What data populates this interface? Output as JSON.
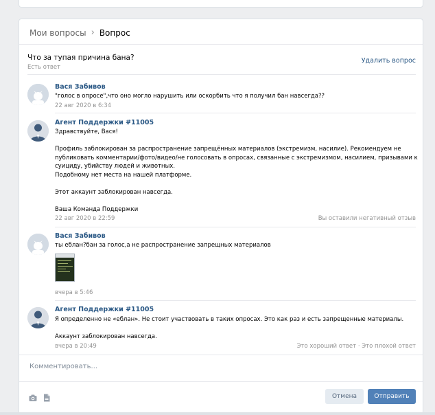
{
  "breadcrumb": {
    "parent": "Мои вопросы",
    "separator": "›",
    "current": "Вопрос"
  },
  "question": {
    "title": "Что за тупая причина бана?",
    "status": "Есть ответ",
    "delete_label": "Удалить вопрос"
  },
  "messages": [
    {
      "author": "Вася Забивов",
      "text": "\"голос в опросе\",что оно могло нарушить или оскорбить что я получил бан навсегда??",
      "date": "22 авг 2020 в 6:34"
    },
    {
      "author": "Агент Поддержки #11005",
      "text": "Здравствуйте, Вася!\n\nПрофиль заблокирован за распространение запрещённых материалов (экстремизм, насилие). Рекомендуем не публиковать комментарии/фото/видео/не голосовать в опросах, связанные с экстремизмом, насилием, призывами к суициду, убийству людей и животных.\nПодобному нет места на нашей платформе.\n\nЭтот аккаунт заблокирован навсегда.\n\nВаша Команда Поддержки",
      "date": "22 авг 2020 в 22:59",
      "rating": "Вы оставили негативный отзыв"
    },
    {
      "author": "Вася Забивов",
      "text": "ты еблан?бан за голос,а не распространение запрещных материалов",
      "date": "вчера в 5:46"
    },
    {
      "author": "Агент Поддержки #11005",
      "text": "Я определенно не «еблан». Не стоит участвовать в таких опросах. Это как раз и есть запрещенные материалы.\n\nАккаунт заблокирован навсегда.",
      "date": "вчера в 20:49",
      "good_label": "Это хороший ответ",
      "dot": "·",
      "bad_label": "Это плохой ответ"
    }
  ],
  "comment": {
    "placeholder": "Комментировать..."
  },
  "icons": {
    "camera": "camera-icon",
    "document": "document-icon"
  },
  "buttons": {
    "cancel": "Отмена",
    "send": "Отправить"
  },
  "colors": {
    "link": "#2a5885",
    "primary_button": "#5181b8",
    "secondary_button": "#e5ebf1",
    "background": "#edeef0"
  }
}
